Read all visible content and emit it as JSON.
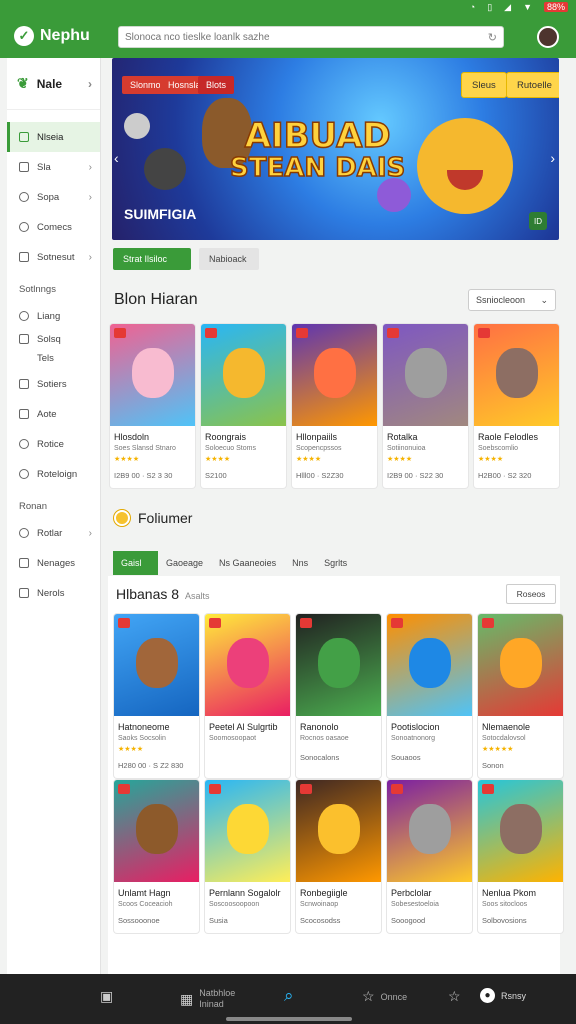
{
  "status_bar": {
    "icons": [
      "alarm-icon",
      "vibrate-icon",
      "signal-icon",
      "wifi-icon",
      "battery-icon"
    ],
    "battery": "88%"
  },
  "app": {
    "logo_text": "Nephu",
    "brand_color": "#3a9b39"
  },
  "search": {
    "placeholder": "Slonoca nco tieslke loanlk sazhe"
  },
  "sidebar": {
    "header": "Nale",
    "items": [
      {
        "label": "Nlseia",
        "icon": "home-icon",
        "active": true
      },
      {
        "label": "Sla",
        "icon": "grid-icon",
        "chevron": true
      },
      {
        "label": "Sopa",
        "icon": "controller-icon",
        "chevron": true
      },
      {
        "label": "Comecs",
        "icon": "clock-icon"
      },
      {
        "label": "Sotnesut",
        "icon": "list-icon",
        "chevron": true
      }
    ],
    "section1": "Sotlnngs",
    "items2": [
      {
        "label": "Liang",
        "icon": "eye-icon"
      },
      {
        "label": "Solsq",
        "icon": "triangle-icon"
      },
      {
        "label": "Tels",
        "icon": "tag-icon"
      },
      {
        "label": "Sotiers",
        "icon": "gamepad-icon"
      },
      {
        "label": "Aote",
        "icon": "music-icon"
      },
      {
        "label": "Rotice",
        "icon": "circle-icon"
      },
      {
        "label": "Roteloign",
        "icon": "clock-icon"
      }
    ],
    "section2": "Ronan",
    "items3": [
      {
        "label": "Rotlar",
        "icon": "settings-icon",
        "chevron": true
      },
      {
        "label": "Nenages",
        "icon": "image-icon"
      },
      {
        "label": "Nerols",
        "icon": "list-icon"
      }
    ]
  },
  "banner": {
    "tags": [
      "Slonmor",
      "Hosnsla",
      "Blots"
    ],
    "buttons": [
      "Sleus",
      "Rutoelle"
    ],
    "title_line1": "AIBUAD",
    "title_line2": "STEAN DAIS",
    "subtitle": "SUIMFIGIA",
    "badge": "ID"
  },
  "filter_tabs": {
    "active": "Strat Ilsiloc",
    "inactive": "Nabioack"
  },
  "section_hot": {
    "title": "Blon Hiaran",
    "sort": "Ssniocleoon"
  },
  "hot_games": [
    {
      "name": "Hlosdoln",
      "sub": "Soes Slansd Stnaro",
      "stars": "★★★★",
      "meta": "I2B9 00 · S2 3 30",
      "color_a": "#f06292",
      "color_b": "#4fc3f7",
      "blob": "#f8bbd0"
    },
    {
      "name": "Roongrais",
      "sub": "Soloecuo Stoms",
      "stars": "★★★★",
      "meta": "S2100",
      "color_a": "#29b6f6",
      "color_b": "#8bc34a",
      "blob": "#f5b82e"
    },
    {
      "name": "Hllonpaiils",
      "sub": "Scopencpssos",
      "stars": "★★★★",
      "meta": "Hlll00 · S2Z30",
      "color_a": "#5e35b1",
      "color_b": "#ff9800",
      "blob": "#ff7043"
    },
    {
      "name": "Rotalka",
      "sub": "Sotiinonuioa",
      "stars": "★★★★",
      "meta": "I2B9 00 · S22 30",
      "color_a": "#7e57c2",
      "color_b": "#a1887f",
      "blob": "#9e9e9e"
    },
    {
      "name": "Raole Felodles",
      "sub": "Soebscomlio",
      "stars": "★★★★",
      "meta": "H2B00 · S2 320",
      "color_a": "#ff7043",
      "color_b": "#ffca28",
      "blob": "#8d6e63"
    }
  ],
  "featured": {
    "title": "Foliumer"
  },
  "category_tabs": [
    "Gaisl",
    "Gaoeage",
    "Ns Gaaneoies",
    "Nns",
    "Sgrlts"
  ],
  "featured_panel": {
    "title": "Hlbanas 8",
    "subtitle": "Asalts",
    "button": "Roseos"
  },
  "featured_row1": [
    {
      "name": "Hatnoneome",
      "sub": "Saoks Socsolin",
      "stars": "★★★★",
      "meta": "H280 00 · S Z2 830",
      "color_a": "#42a5f5",
      "color_b": "#1565c0",
      "blob": "#a1663a"
    },
    {
      "name": "Peetel Al Sulgrtib",
      "sub": "Soomosoopaot",
      "stars": "",
      "meta": "",
      "color_a": "#ffeb3b",
      "color_b": "#e91e63",
      "blob": "#ec407a"
    },
    {
      "name": "Ranonolo",
      "sub": "Rocnos oasaoe",
      "stars": "",
      "meta": "Sonocalons",
      "color_a": "#212121",
      "color_b": "#4caf50",
      "blob": "#43a047"
    },
    {
      "name": "Pootislocion",
      "sub": "Sonoatnonorg",
      "stars": "",
      "meta": "Souaoos",
      "color_a": "#ff8f00",
      "color_b": "#4fc3f7",
      "blob": "#1e88e5"
    },
    {
      "name": "Nlemaenole",
      "sub": "Sotocdalovsol",
      "stars": "★★★★★",
      "meta": "Sonon",
      "color_a": "#66bb6a",
      "color_b": "#e53935",
      "blob": "#ffa726"
    }
  ],
  "featured_row2": [
    {
      "name": "Unlamt Hagn",
      "sub": "Scoos Coceacioh",
      "meta": "Sossooonoe",
      "color_a": "#26a69a",
      "color_b": "#e91e63",
      "blob": "#8d5a2b"
    },
    {
      "name": "Pernlann Sogalolr",
      "sub": "Soscoosoopoon",
      "meta": "Susia",
      "color_a": "#29b6f6",
      "color_b": "#ffee58",
      "blob": "#fdd835"
    },
    {
      "name": "Ronbegiigle",
      "sub": "Scnwoinaop",
      "meta": "Scocosodss",
      "color_a": "#3e2723",
      "color_b": "#ff9800",
      "blob": "#fbc02d"
    },
    {
      "name": "Perbclolar",
      "sub": "Sobesestoeloia",
      "meta": "Sooogood",
      "color_a": "#7b1fa2",
      "color_b": "#ffca28",
      "blob": "#9e9e9e"
    },
    {
      "name": "Nenlua Pkom",
      "sub": "Soos sitocloos",
      "meta": "Solbovosions",
      "color_a": "#26c6da",
      "color_b": "#ffb300",
      "blob": "#8d6e63"
    }
  ],
  "bottom_nav": [
    {
      "label": "",
      "icon": "tablet-icon"
    },
    {
      "label": "Natbhloe Ininad",
      "icon": "grid-icon"
    },
    {
      "label": "",
      "icon": "search-icon",
      "active": true
    },
    {
      "label": "Onnce",
      "icon": "star-icon"
    },
    {
      "label": "",
      "icon": "star-icon"
    },
    {
      "label": "Rsnsy",
      "icon": "user-icon"
    }
  ]
}
